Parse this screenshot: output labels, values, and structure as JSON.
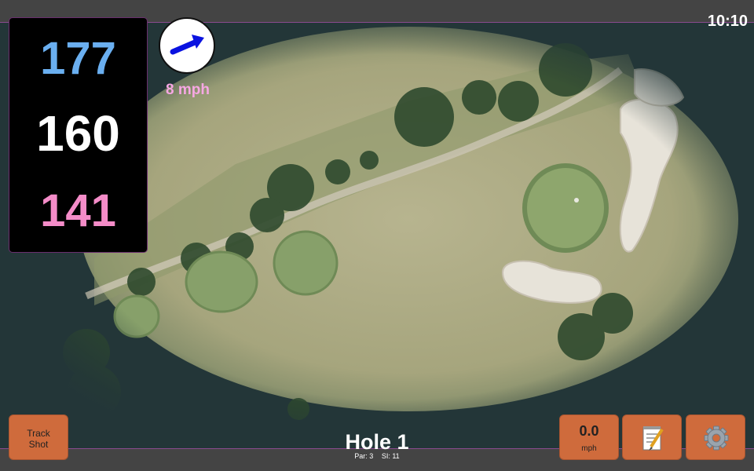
{
  "status": {
    "time": "10:10"
  },
  "distances": {
    "back": "177",
    "middle": "160",
    "front": "141"
  },
  "wind": {
    "speed_label": "8 mph",
    "direction_icon": "arrow-icon"
  },
  "buttons": {
    "track_shot_line1": "Track",
    "track_shot_line2": "Shot",
    "speed_value": "0.0",
    "speed_unit": "mph",
    "notes_icon": "notepad-icon",
    "settings_icon": "gear-icon"
  },
  "hole": {
    "title": "Hole 1",
    "par": "Par: 3",
    "stroke_index": "SI: 11"
  },
  "colors": {
    "back_distance": "#6aaff0",
    "middle_distance": "#ffffff",
    "front_distance": "#f48cc8",
    "button": "#cf6b3c",
    "wind_label": "#f6a7e3"
  }
}
